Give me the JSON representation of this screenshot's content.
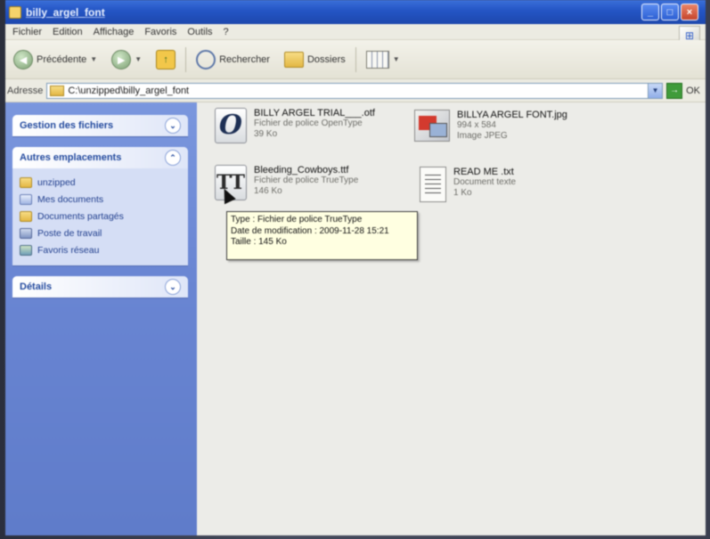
{
  "window": {
    "title": "billy_argel_font"
  },
  "menubar": {
    "items": [
      "Fichier",
      "Edition",
      "Affichage",
      "Favoris",
      "Outils",
      "?"
    ]
  },
  "toolbar": {
    "back_label": "Précédente",
    "search_label": "Rechercher",
    "folders_label": "Dossiers"
  },
  "address": {
    "label": "Adresse",
    "path": "C:\\unzipped\\billy_argel_font",
    "go_label": "OK"
  },
  "taskpane": {
    "file_tasks": {
      "title": "Gestion des fichiers"
    },
    "other_places": {
      "title": "Autres emplacements",
      "items": [
        {
          "label": "unzipped",
          "icon": "folder-icon"
        },
        {
          "label": "Mes documents",
          "icon": "documents-icon"
        },
        {
          "label": "Documents partagés",
          "icon": "folder-icon"
        },
        {
          "label": "Poste de travail",
          "icon": "computer-icon"
        },
        {
          "label": "Favoris réseau",
          "icon": "network-icon"
        }
      ]
    },
    "details": {
      "title": "Détails"
    }
  },
  "files": [
    {
      "name": "BILLY ARGEL TRIAL___.otf",
      "type": "Fichier de police OpenType",
      "size": "39 Ko",
      "icon": "opentype-font-icon"
    },
    {
      "name": "BILLYA ARGEL FONT.jpg",
      "type": "994 x 584",
      "size": "Image JPEG",
      "icon": "jpeg-image-icon"
    },
    {
      "name": "Bleeding_Cowboys.ttf",
      "type": "Fichier de police TrueType",
      "size": "146 Ko",
      "icon": "truetype-font-icon"
    },
    {
      "name": "READ ME .txt",
      "type": "Document texte",
      "size": "1 Ko",
      "icon": "text-document-icon"
    }
  ],
  "tooltip": {
    "line1": "Type : Fichier de police TrueType",
    "line2": "Date de modification : 2009-11-28 15:21",
    "line3": "Taille : 145 Ko"
  }
}
